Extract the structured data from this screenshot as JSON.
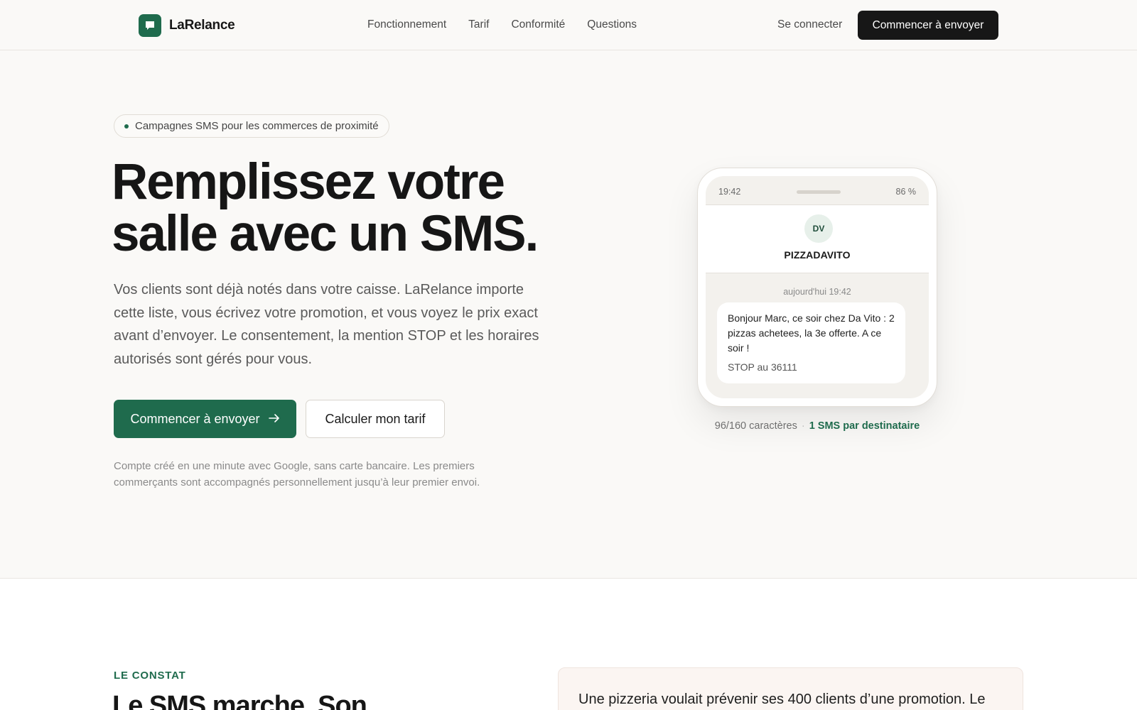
{
  "brand": {
    "name": "LaRelance",
    "logo_icon": "chat-bubble-icon",
    "color": "#1f6b4d"
  },
  "nav": {
    "links": [
      "Fonctionnement",
      "Tarif",
      "Conformité",
      "Questions"
    ],
    "login": "Se connecter",
    "cta": "Commencer à envoyer"
  },
  "hero": {
    "badge": "Campagnes SMS pour les commerces de proximité",
    "title_line1": "Remplissez votre",
    "title_line2": "salle avec un SMS.",
    "lead": "Vos clients sont déjà notés dans votre caisse. LaRelance importe cette liste, vous écrivez votre promotion, et vous voyez le prix exact avant d’envoyer. Le consentement, la mention STOP et les horaires autorisés sont gérés pour vous.",
    "primary_cta": "Commencer à envoyer",
    "primary_cta_icon": "arrow-right-icon",
    "secondary_cta": "Calculer mon tarif",
    "note": "Compte créé en une minute avec Google, sans carte bancaire. Les premiers commerçants sont accompagnés personnellement jusqu’à leur premier envoi."
  },
  "phone": {
    "time": "19:42",
    "battery": "86 %",
    "avatar_initials": "DV",
    "contact_name": "PIZZADAVITO",
    "message_date": "aujourd'hui 19:42",
    "message_body": "Bonjour Marc, ce soir chez Da Vito : 2 pizzas achetees, la 3e offerte. A ce soir !",
    "message_stop": "STOP au 36111",
    "char_count": "96/160 caractères",
    "sms_count": "1 SMS par destinataire"
  },
  "section2": {
    "eyebrow": "LE CONSTAT",
    "title": "Le SMS marche. Son",
    "story": "Une pizzeria voulait prévenir ses 400 clients d’une promotion. Le"
  }
}
